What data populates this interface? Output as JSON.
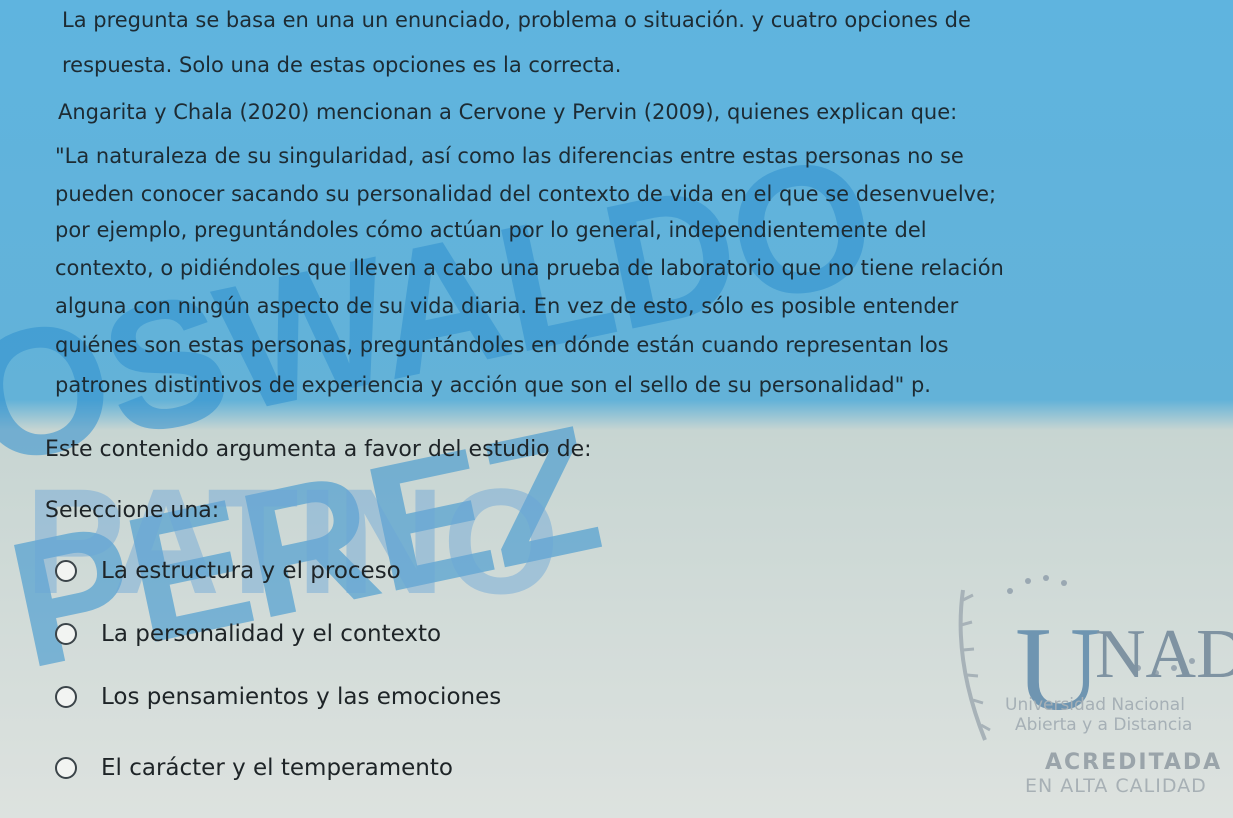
{
  "watermark": {
    "line1": "OSWALDO PEREZ",
    "line2": "PATINO"
  },
  "question": {
    "instruction_line1": "La pregunta se basa en una un enunciado, problema o situación. y cuatro opciones de",
    "instruction_line2": "respuesta. Solo una de estas opciones es la correcta.",
    "intro": "Angarita y Chala (2020) mencionan a Cervone y Pervin (2009), quienes explican que:",
    "quote_lines": [
      "\"La naturaleza de su singularidad, así como las diferencias entre estas personas no se",
      "pueden conocer sacando su personalidad del contexto de vida en el que se desenvuelve;",
      "por ejemplo, preguntándoles cómo actúan por lo general, independientemente del",
      "contexto, o pidiéndoles que lleven a cabo una prueba de laboratorio que no tiene relación",
      "alguna con ningún aspecto de su vida diaria. En vez de esto, sólo es posible entender",
      "quiénes son estas personas, preguntándoles en dónde están cuando representan los",
      "patrones distintivos de experiencia y acción que son el sello de su personalidad\" p."
    ],
    "prompt": "Este contenido argumenta a favor del estudio de:",
    "select_label": "Seleccione una:"
  },
  "options": [
    "La estructura y el proceso",
    "La personalidad y el contexto",
    "Los pensamientos y las emociones",
    "El carácter y el temperamento"
  ],
  "logo": {
    "letter_u": "U",
    "letters_ad": "NAD",
    "line1": "Universidad Nacional",
    "line2": "Abierta y a Distancia",
    "line3": "ACREDITADA",
    "line4": "EN ALTA CALIDAD"
  },
  "colors": {
    "top_background": "#5fb4df",
    "bottom_background": "#dde2df",
    "watermark": "#2f90cf"
  }
}
